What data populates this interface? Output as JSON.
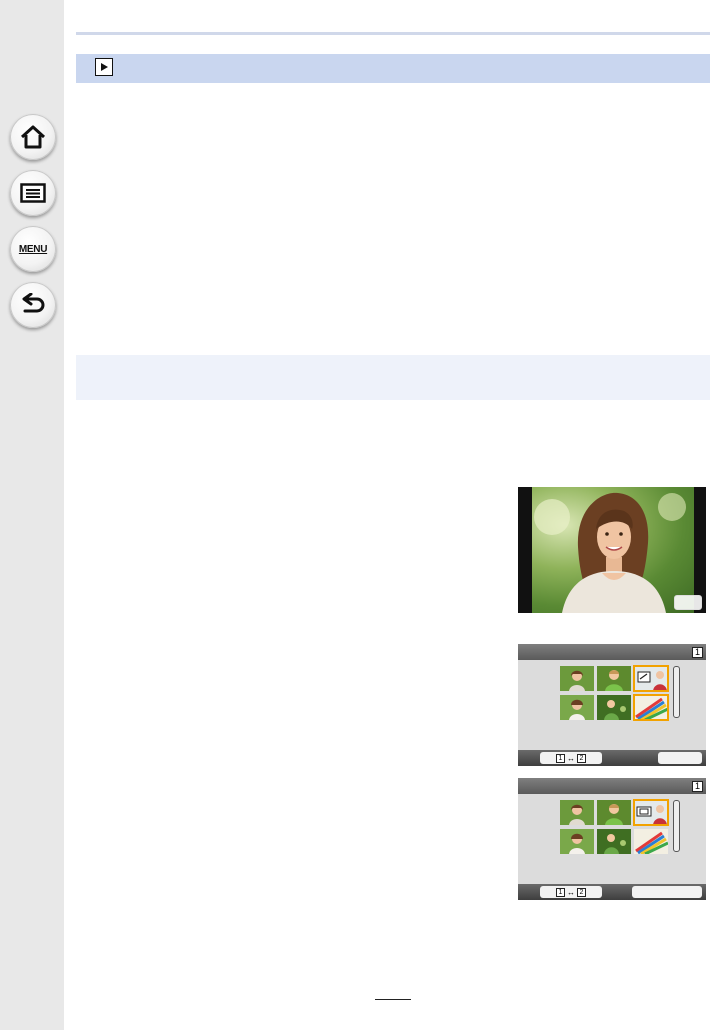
{
  "sidebar": {
    "items": [
      {
        "icon": "home-icon"
      },
      {
        "icon": "contents-list-icon"
      },
      {
        "icon": "menu-icon",
        "label": "MENU"
      },
      {
        "icon": "back-icon"
      }
    ]
  },
  "header": {
    "icon": "playback-icon"
  },
  "screens": [
    {
      "page_indicator": "1",
      "swap_left": "1",
      "swap_right": "2"
    },
    {
      "page_indicator": "1",
      "swap_left": "1",
      "swap_right": "2"
    }
  ],
  "colors": {
    "sidebar": "#e8e8e8",
    "header_bar": "#c9d6ef",
    "section_bar": "#eef2fa",
    "highlight": "#f2a200"
  }
}
